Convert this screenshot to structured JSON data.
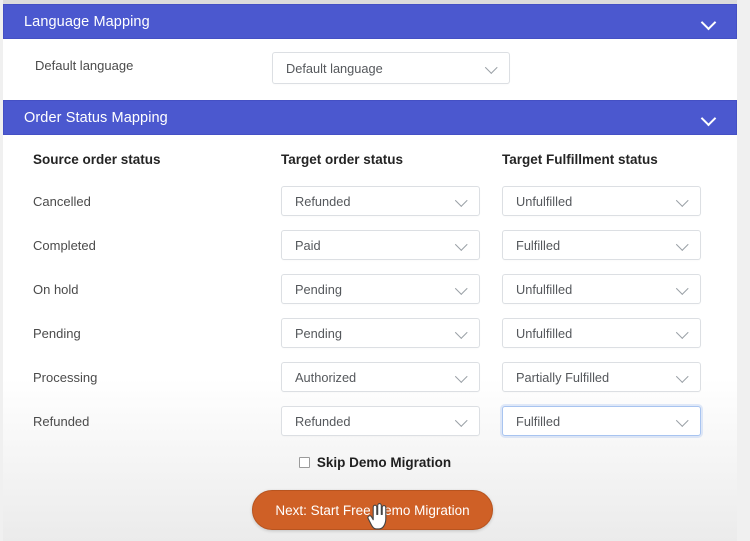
{
  "sections": {
    "language": {
      "title": "Language Mapping",
      "chevron_icon": "chevron-down-icon",
      "header_color": "#4b58cf",
      "default_language": {
        "label": "Default language",
        "value": "Default language"
      }
    },
    "order_status": {
      "title": "Order Status Mapping",
      "chevron_icon": "chevron-down-icon",
      "header_color": "#4b58cf"
    }
  },
  "table": {
    "headers": {
      "source": "Source order status",
      "target": "Target order status",
      "fulfillment": "Target Fulfillment status"
    },
    "rows": [
      {
        "source": "Cancelled",
        "target": "Refunded",
        "fulfillment": "Unfulfilled",
        "fulfillment_focused": false
      },
      {
        "source": "Completed",
        "target": "Paid",
        "fulfillment": "Fulfilled",
        "fulfillment_focused": false
      },
      {
        "source": "On hold",
        "target": "Pending",
        "fulfillment": "Unfulfilled",
        "fulfillment_focused": false
      },
      {
        "source": "Pending",
        "target": "Pending",
        "fulfillment": "Unfulfilled",
        "fulfillment_focused": false
      },
      {
        "source": "Processing",
        "target": "Authorized",
        "fulfillment": "Partially Fulfilled",
        "fulfillment_focused": false
      },
      {
        "source": "Refunded",
        "target": "Refunded",
        "fulfillment": "Fulfilled",
        "fulfillment_focused": true
      }
    ]
  },
  "skip": {
    "label": "Skip Demo Migration",
    "checked": false
  },
  "cta": {
    "label": "Next: Start Free Demo Migration",
    "color": "#cf6026"
  },
  "cursor": {
    "icon": "pointing-hand-cursor"
  }
}
